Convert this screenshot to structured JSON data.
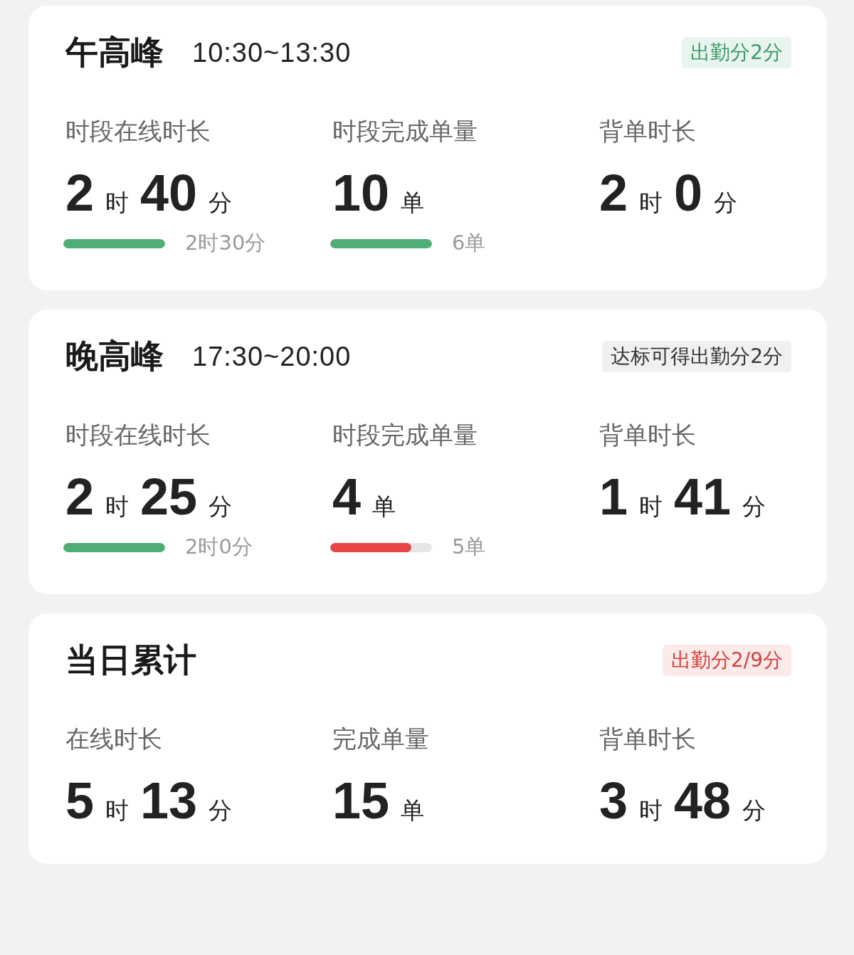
{
  "cards": [
    {
      "title": "午高峰",
      "time": "10:30~13:30",
      "badge": {
        "text": "出勤分2分",
        "kind": "achieved"
      },
      "metrics": [
        {
          "label": "时段在线时长",
          "value": [
            {
              "text": "2",
              "kind": "number"
            },
            {
              "text": "时",
              "kind": "unit"
            },
            {
              "text": "40",
              "kind": "number"
            },
            {
              "text": "分",
              "kind": "unit"
            }
          ],
          "progress": {
            "level": 1,
            "color": "#4fae78",
            "target": "2时30分"
          }
        },
        {
          "label": "时段完成单量",
          "value": [
            {
              "text": "10",
              "kind": "number"
            },
            {
              "text": "单",
              "kind": "unit"
            }
          ],
          "progress": {
            "level": 1,
            "color": "#4fae78",
            "target": "6单"
          }
        },
        {
          "label": "背单时长",
          "value": [
            {
              "text": "2",
              "kind": "number"
            },
            {
              "text": "时",
              "kind": "unit"
            },
            {
              "text": "0",
              "kind": "number"
            },
            {
              "text": "分",
              "kind": "unit"
            }
          ]
        }
      ]
    },
    {
      "title": "晚高峰",
      "time": "17:30~20:00",
      "badge": {
        "text": "达标可得出勤分2分",
        "kind": "pending"
      },
      "metrics": [
        {
          "label": "时段在线时长",
          "value": [
            {
              "text": "2",
              "kind": "number"
            },
            {
              "text": "时",
              "kind": "unit"
            },
            {
              "text": "25",
              "kind": "number"
            },
            {
              "text": "分",
              "kind": "unit"
            }
          ],
          "progress": {
            "level": 1,
            "color": "#4fae78",
            "target": "2时0分"
          }
        },
        {
          "label": "时段完成单量",
          "value": [
            {
              "text": "4",
              "kind": "number"
            },
            {
              "text": "单",
              "kind": "unit"
            }
          ],
          "progress": {
            "level": 0.8,
            "color": "#e84646",
            "target": "5单"
          }
        },
        {
          "label": "背单时长",
          "value": [
            {
              "text": "1",
              "kind": "number"
            },
            {
              "text": "时",
              "kind": "unit"
            },
            {
              "text": "41",
              "kind": "number"
            },
            {
              "text": "分",
              "kind": "unit"
            }
          ]
        }
      ]
    },
    {
      "title": "当日累计",
      "badge": {
        "text": "出勤分2/9分",
        "kind": "deficit"
      },
      "metrics": [
        {
          "label": "在线时长",
          "value": [
            {
              "text": "5",
              "kind": "number"
            },
            {
              "text": "时",
              "kind": "unit"
            },
            {
              "text": "13",
              "kind": "number"
            },
            {
              "text": "分",
              "kind": "unit"
            }
          ]
        },
        {
          "label": "完成单量",
          "value": [
            {
              "text": "15",
              "kind": "number"
            },
            {
              "text": "单",
              "kind": "unit"
            }
          ]
        },
        {
          "label": "背单时长",
          "value": [
            {
              "text": "3",
              "kind": "number"
            },
            {
              "text": "时",
              "kind": "unit"
            },
            {
              "text": "48",
              "kind": "number"
            },
            {
              "text": "分",
              "kind": "unit"
            }
          ]
        }
      ]
    }
  ]
}
